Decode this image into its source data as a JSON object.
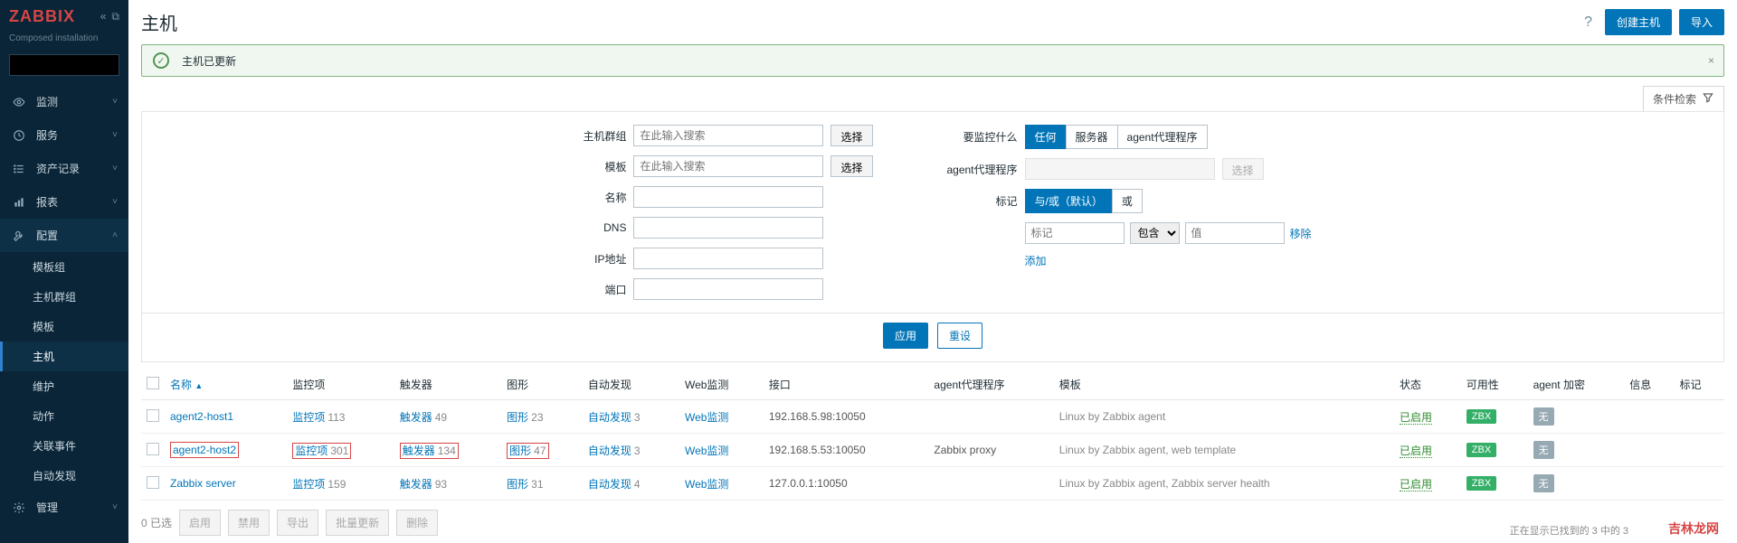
{
  "brand": {
    "logo": "ZABBIX",
    "subtitle": "Composed installation"
  },
  "sidebar": {
    "search_placeholder": "",
    "items": [
      {
        "icon": "eye",
        "label": "监测"
      },
      {
        "icon": "clock",
        "label": "服务"
      },
      {
        "icon": "list",
        "label": "资产记录"
      },
      {
        "icon": "chart",
        "label": "报表"
      },
      {
        "icon": "wrench",
        "label": "配置",
        "expanded": true,
        "children": [
          {
            "label": "模板组"
          },
          {
            "label": "主机群组"
          },
          {
            "label": "模板"
          },
          {
            "label": "主机",
            "active": true
          },
          {
            "label": "维护"
          },
          {
            "label": "动作"
          },
          {
            "label": "关联事件"
          },
          {
            "label": "自动发现"
          }
        ]
      },
      {
        "icon": "gear",
        "label": "管理"
      }
    ]
  },
  "page": {
    "title": "主机"
  },
  "actions": {
    "create": "创建主机",
    "import": "导入"
  },
  "notice": {
    "text": "主机已更新"
  },
  "filter": {
    "tab": "条件检索",
    "left": {
      "hostgroup": {
        "label": "主机群组",
        "placeholder": "在此输入搜索",
        "btn": "选择"
      },
      "template": {
        "label": "模板",
        "placeholder": "在此输入搜索",
        "btn": "选择"
      },
      "name": {
        "label": "名称"
      },
      "dns": {
        "label": "DNS"
      },
      "ip": {
        "label": "IP地址"
      },
      "port": {
        "label": "端口"
      }
    },
    "right": {
      "monitor": {
        "label": "要监控什么",
        "opts": [
          "任何",
          "服务器",
          "agent代理程序"
        ],
        "active": 0
      },
      "proxy": {
        "label": "agent代理程序",
        "btn": "选择"
      },
      "tag": {
        "label": "标记",
        "opts": [
          "与/或（默认）",
          "或"
        ],
        "active": 0
      },
      "tagrow": {
        "placeholder": "标记",
        "op": "包含",
        "val_placeholder": "值",
        "remove": "移除"
      },
      "add": "添加"
    },
    "apply": "应用",
    "reset": "重设"
  },
  "table": {
    "headers": {
      "name": "名称",
      "items": "监控项",
      "triggers": "触发器",
      "graphs": "图形",
      "discovery": "自动发现",
      "web": "Web监测",
      "interface": "接口",
      "proxy": "agent代理程序",
      "template": "模板",
      "status": "状态",
      "avail": "可用性",
      "encrypt": "agent 加密",
      "info": "信息",
      "tags": "标记"
    },
    "rows": [
      {
        "name": "agent2-host1",
        "items": "监控项",
        "items_c": "113",
        "trig": "触发器",
        "trig_c": "49",
        "graph": "图形",
        "graph_c": "23",
        "disc": "自动发现",
        "disc_c": "3",
        "web": "Web监测",
        "iface": "192.168.5.98:10050",
        "proxy": "",
        "tmpl": "Linux by Zabbix agent",
        "status": "已启用",
        "zbx": "ZBX",
        "enc": "无",
        "hl": false
      },
      {
        "name": "agent2-host2",
        "items": "监控项",
        "items_c": "301",
        "trig": "触发器",
        "trig_c": "134",
        "graph": "图形",
        "graph_c": "47",
        "disc": "自动发现",
        "disc_c": "3",
        "web": "Web监测",
        "iface": "192.168.5.53:10050",
        "proxy": "Zabbix proxy",
        "tmpl": "Linux by Zabbix agent, web template",
        "status": "已启用",
        "zbx": "ZBX",
        "enc": "无",
        "hl": true
      },
      {
        "name": "Zabbix server",
        "items": "监控项",
        "items_c": "159",
        "trig": "触发器",
        "trig_c": "93",
        "graph": "图形",
        "graph_c": "31",
        "disc": "自动发现",
        "disc_c": "4",
        "web": "Web监测",
        "iface": "127.0.0.1:10050",
        "proxy": "",
        "tmpl": "Linux by Zabbix agent, Zabbix server health",
        "status": "已启用",
        "zbx": "ZBX",
        "enc": "无",
        "hl": false
      }
    ]
  },
  "footer": {
    "selected": "0 已选",
    "b1": "启用",
    "b2": "禁用",
    "b3": "导出",
    "b4": "批量更新",
    "b5": "删除",
    "display": "正在显示已找到的 3 中的 3"
  },
  "watermark": "吉林龙网"
}
